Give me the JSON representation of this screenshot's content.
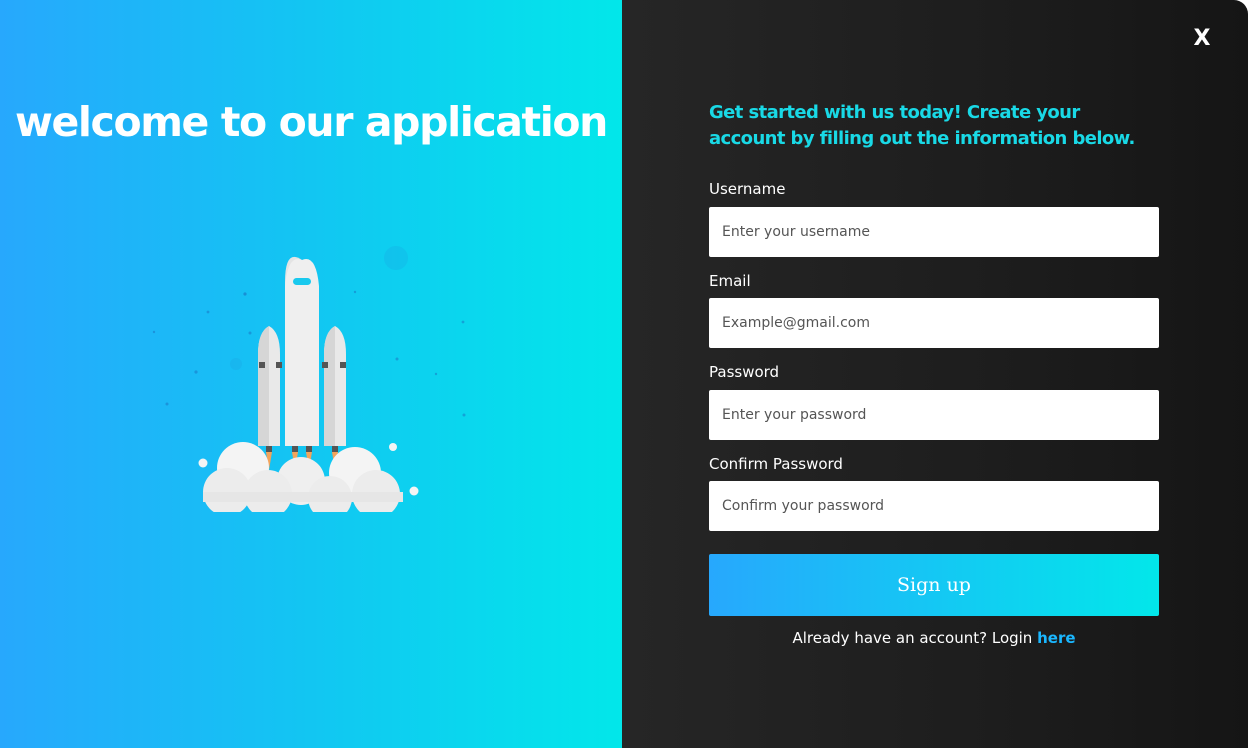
{
  "left": {
    "title": "welcome to our application",
    "illustration": "rocket-launch-illustration"
  },
  "close_label": "X",
  "form": {
    "intro": "Get started with us today! Create your account by filling out the information below.",
    "username": {
      "label": "Username",
      "placeholder": "Enter your username"
    },
    "email": {
      "label": "Email",
      "placeholder": "Example@gmail.com"
    },
    "password": {
      "label": "Password",
      "placeholder": "Enter your password"
    },
    "confirm": {
      "label": "Confirm Password",
      "placeholder": "Confirm your password"
    },
    "submit_label": "Sign up",
    "login_prompt": "Already have an account? Login ",
    "login_link": "here"
  },
  "colors": {
    "gradient_start": "#27a8fd",
    "gradient_end": "#02e7ea",
    "panel_dark": "#1f1f1f",
    "accent_text": "#19d9e6",
    "link": "#1ab7ff"
  }
}
